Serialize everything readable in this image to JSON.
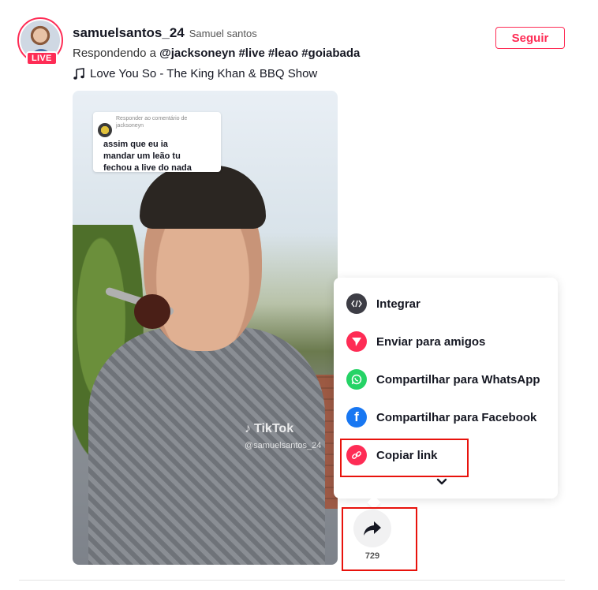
{
  "post": {
    "live_badge": "LIVE",
    "username": "samuelsantos_24",
    "nickname": "Samuel santos",
    "reply_prefix": "Respondendo a",
    "mention": "@jacksoneyn",
    "hashtags": [
      "#live",
      "#leao",
      "#goiabada"
    ],
    "music": "Love You So - The King Khan & BBQ Show",
    "follow_label": "Seguir"
  },
  "video": {
    "comment_card": {
      "label": "Responder ao comentário de",
      "commenter": "jacksoneyn",
      "text_lines": [
        "assim que eu ia",
        "mandar um leão tu",
        "fechou a live do nada"
      ]
    },
    "watermark": "TikTok",
    "watermark_user": "@samuelsantos_24"
  },
  "share_menu": {
    "items": [
      {
        "label": "Integrar",
        "icon": "embed-icon",
        "color": "#3d3d45"
      },
      {
        "label": "Enviar para amigos",
        "icon": "send-icon",
        "color": "#fe2c55"
      },
      {
        "label": "Compartilhar para WhatsApp",
        "icon": "whatsapp-icon",
        "color": "#25d366"
      },
      {
        "label": "Compartilhar para Facebook",
        "icon": "facebook-icon",
        "color": "#1877f2"
      },
      {
        "label": "Copiar link",
        "icon": "link-icon",
        "color": "#fe2c55"
      }
    ],
    "expand_icon": "chevron-down-icon"
  },
  "share_button": {
    "icon": "share-arrow-icon",
    "count": "729"
  },
  "colors": {
    "accent": "#fe2c55",
    "highlight": "#e8120c"
  }
}
